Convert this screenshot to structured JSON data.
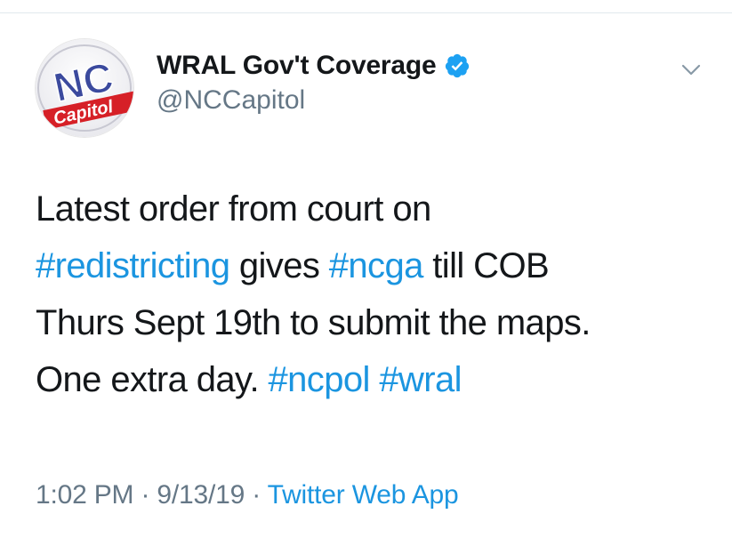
{
  "author": {
    "display_name": "WRAL Gov't Coverage",
    "handle": "@NCCapitol",
    "verified_icon": "verified-badge-icon",
    "avatar": {
      "logo_main": "NC",
      "logo_sub": "Capitol",
      "colors": {
        "red": "#d62027",
        "blue": "#3b4a9e"
      }
    }
  },
  "tweet": {
    "lines": [
      [
        {
          "text": "Latest order from court on",
          "type": "text"
        }
      ],
      [
        {
          "text": "#redistricting",
          "type": "hashtag"
        },
        {
          "text": " gives ",
          "type": "text"
        },
        {
          "text": "#ncga",
          "type": "hashtag"
        },
        {
          "text": " till COB",
          "type": "text"
        }
      ],
      [
        {
          "text": "Thurs Sept 19th to submit the maps.",
          "type": "text"
        }
      ],
      [
        {
          "text": "One extra day. ",
          "type": "text"
        },
        {
          "text": "#ncpol",
          "type": "hashtag"
        },
        {
          "text": " ",
          "type": "text"
        },
        {
          "text": "#wral",
          "type": "hashtag"
        }
      ]
    ]
  },
  "meta": {
    "time": "1:02 PM",
    "separator": " · ",
    "date": "9/13/19",
    "source": "Twitter Web App"
  },
  "colors": {
    "link": "#1b95e0",
    "secondary": "#657786",
    "text": "#14171a"
  },
  "menu_icon": "chevron-down-icon"
}
